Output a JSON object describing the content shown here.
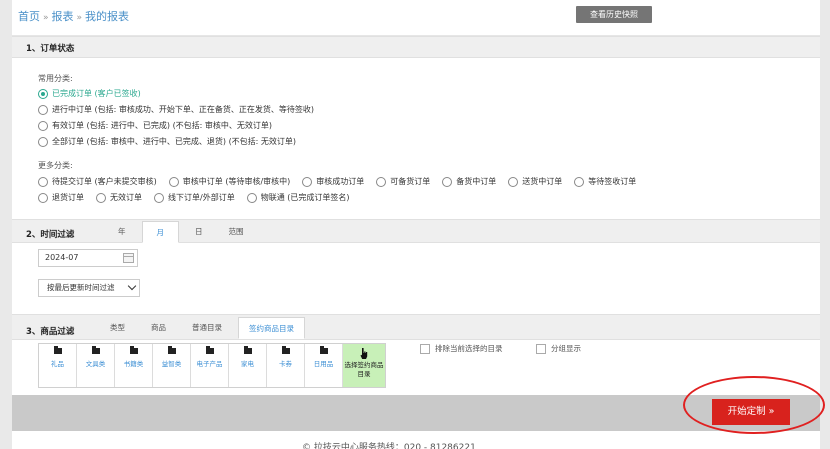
{
  "breadcrumb": [
    "首页",
    "报表",
    "我的报表"
  ],
  "breadcrumb_separator": "»",
  "history_button": "查看历史快照",
  "order_status": {
    "title": "1、订单状态",
    "common_label": "常用分类:",
    "common_options": [
      "已完成订单 (客户已签收)",
      "进行中订单 (包括: 审核成功、开始下单、正在备货、正在发货、等待签收)",
      "有效订单 (包括: 进行中、已完成) (不包括: 审核中、无效订单)",
      "全部订单 (包括: 审核中、进行中、已完成、退货) (不包括: 无效订单)"
    ],
    "more_label": "更多分类:",
    "more_options_row1": [
      "待提交订单 (客户未提交审核)",
      "审核中订单 (等待审核/审核中)",
      "审核成功订单",
      "可备货订单",
      "备货中订单",
      "送货中订单",
      "等待签收订单"
    ],
    "more_options_row2": [
      "退货订单",
      "无效订单",
      "线下订单/外部订单",
      "物联通 (已完成订单签名)"
    ]
  },
  "time_filter": {
    "title": "2、时间过滤",
    "tabs": [
      "年",
      "月",
      "日",
      "范围"
    ],
    "active_tab": "月",
    "date_value": "2024-07",
    "sort_select": "按最后更新时间过滤"
  },
  "product_filter": {
    "title": "3、商品过滤",
    "tabs": [
      "类型",
      "商品",
      "普通目录",
      "签约商品目录"
    ],
    "active_tab": "签约商品目录",
    "categories": [
      "礼品",
      "文具类",
      "书籍类",
      "益智类",
      "电子产品",
      "家电",
      "卡券",
      "日用品"
    ],
    "selected_category": "选择签约商品目录",
    "exclude_label": "排除当前选择的目录",
    "group_label": "分组显示"
  },
  "start_button": "开始定制 »",
  "footer_text": "© 拉技云中心服务热线：020 - 81286221",
  "colors": {
    "link": "#4a90c8",
    "accent_green": "#2ba88f",
    "start_red": "#d8221d"
  }
}
